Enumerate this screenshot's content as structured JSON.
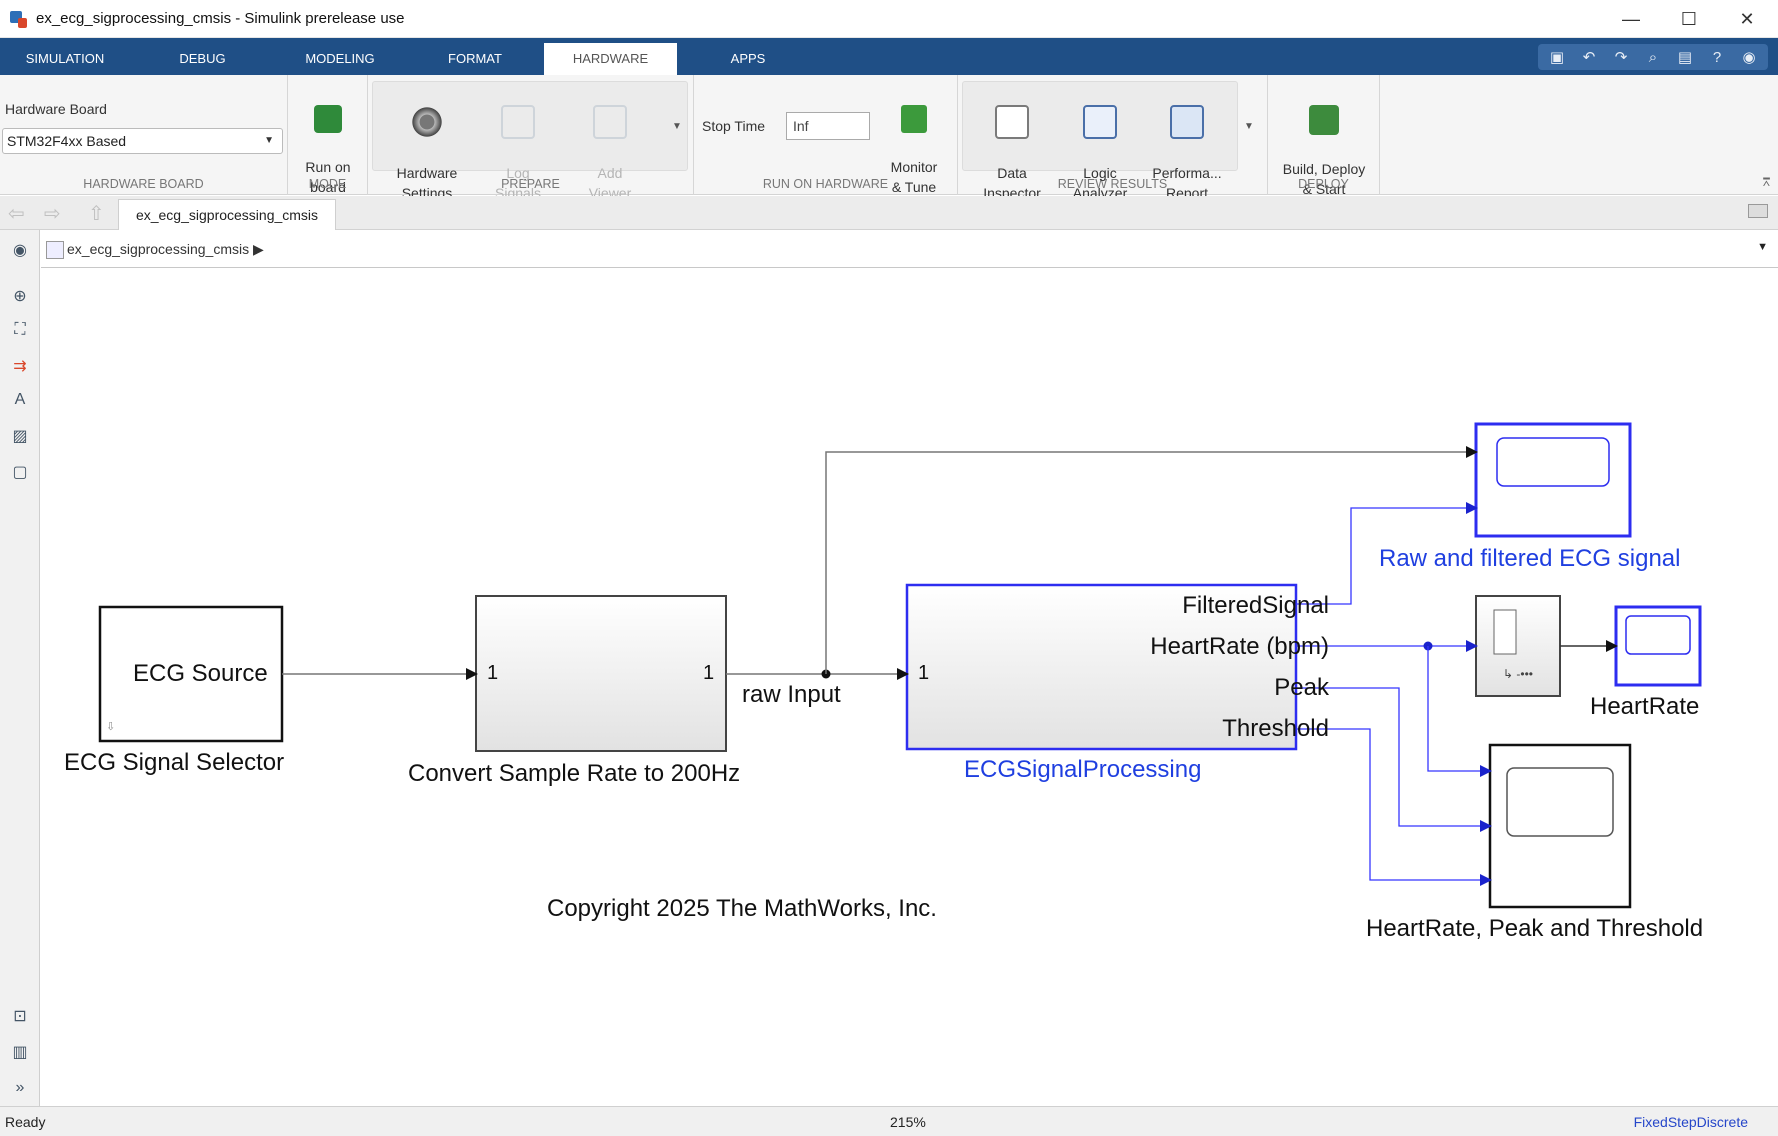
{
  "window": {
    "title": "ex_ecg_sigprocessing_cmsis - Simulink prerelease use",
    "minimize": "—",
    "maximize": "☐",
    "close": "✕"
  },
  "tabs": [
    "SIMULATION",
    "DEBUG",
    "MODELING",
    "FORMAT",
    "HARDWARE",
    "APPS"
  ],
  "active_tab": "HARDWARE",
  "ribbon": {
    "hardware_board": {
      "label": "Hardware Board",
      "selected": "STM32F4xx Based",
      "caption": "HARDWARE BOARD"
    },
    "mode": {
      "run_on_board": "Run on\nboard",
      "caption": "MODE"
    },
    "prepare": {
      "hardware_settings": "Hardware\nSettings",
      "log_signals": "Log\nSignals",
      "add_viewer": "Add\nViewer",
      "caption": "PREPARE"
    },
    "run_on_hardware": {
      "stop_time_label": "Stop Time",
      "stop_time_value": "Inf",
      "monitor_tune": "Monitor\n& Tune",
      "caption": "RUN ON HARDWARE"
    },
    "review_results": {
      "data_inspector": "Data\nInspector",
      "logic_analyzer": "Logic\nAnalyzer",
      "performance_report": "Performa...\nReport",
      "caption": "REVIEW RESULTS"
    },
    "deploy": {
      "build_deploy_start": "Build, Deploy\n& Start",
      "caption": "DEPLOY"
    }
  },
  "model_tab": "ex_ecg_sigprocessing_cmsis",
  "breadcrumb": "ex_ecg_sigprocessing_cmsis",
  "diagram": {
    "ecg_source_text": "ECG Source",
    "ecg_selector_label": "ECG Signal Selector",
    "convert_in_port": "1",
    "convert_out_port": "1",
    "convert_label": "Convert Sample Rate to 200Hz",
    "raw_input_label": "raw Input",
    "processing_in_port": "1",
    "processing_ports": [
      "FilteredSignal",
      "HeartRate (bpm)",
      "Peak",
      "Threshold"
    ],
    "processing_label": "ECGSignalProcessing",
    "scope_raw_label": "Raw and filtered ECG signal",
    "heartrate_label": "HeartRate",
    "scope_triple_label": "HeartRate, Peak and Threshold",
    "copyright": "Copyright 2025 The MathWorks, Inc."
  },
  "status": {
    "left": "Ready",
    "zoom": "215%",
    "solver": "FixedStepDiscrete"
  },
  "colors": {
    "tab_strip": "#1f4f86",
    "blue_link": "#1f3fe0",
    "signal_line": "#3535ff"
  }
}
